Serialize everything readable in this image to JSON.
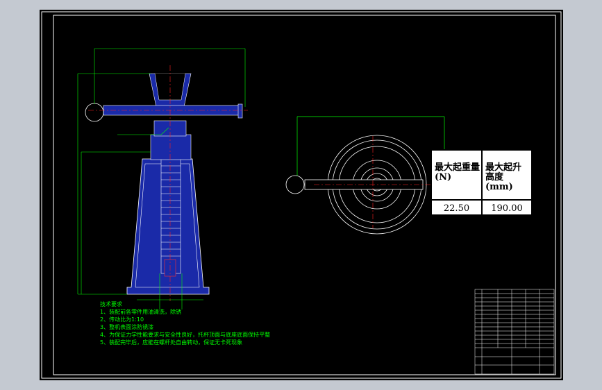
{
  "spec_table": {
    "header_load": "最大起重量(N)",
    "header_height": "最大起升高度(mm)",
    "value_load": "22.50",
    "value_height": "190.00"
  },
  "tech_requirements": {
    "title": "技术要求",
    "items": [
      "1、装配前各零件用油清洗，除锈",
      "2、传动比为1:10",
      "3、整机表面涂防锈漆",
      "4、为保证力学性能要求与安全性良好，托杯顶面与底座底面保持平整",
      "5、装配完毕后，应能在螺杆处自由转动，保证无卡死现象"
    ]
  },
  "colors": {
    "background": "#000000",
    "frame": "#ffffff",
    "part_fill": "#1a2aa8",
    "dimension": "#00ff00",
    "centerline": "#ff2020",
    "outline": "#ffffff"
  }
}
